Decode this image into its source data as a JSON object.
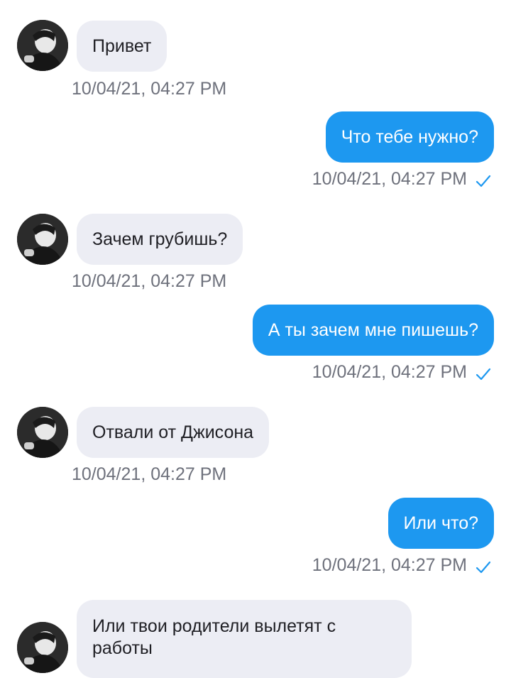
{
  "messages": [
    {
      "direction": "in",
      "text": "Привет",
      "time": "10/04/21, 04:27 PM"
    },
    {
      "direction": "out",
      "text": "Что тебе нужно?",
      "time": "10/04/21, 04:27 PM",
      "status_icon": "checkmark-icon"
    },
    {
      "direction": "in",
      "text": "Зачем грубишь?",
      "time": "10/04/21, 04:27 PM"
    },
    {
      "direction": "out",
      "text": "А ты зачем мне пишешь?",
      "time": "10/04/21, 04:27 PM",
      "status_icon": "checkmark-icon"
    },
    {
      "direction": "in",
      "text": "Отвали от Джисона",
      "time": "10/04/21, 04:27 PM"
    },
    {
      "direction": "out",
      "text": "Или что?",
      "time": "10/04/21, 04:27 PM",
      "status_icon": "checkmark-icon"
    },
    {
      "direction": "in",
      "text": "Или твои родители вылетят с работы",
      "time": ""
    }
  ],
  "colors": {
    "incoming_bubble": "#ecedf4",
    "outgoing_bubble": "#1d98f0",
    "timestamp": "#6e717c",
    "check": "#1d98f0"
  }
}
